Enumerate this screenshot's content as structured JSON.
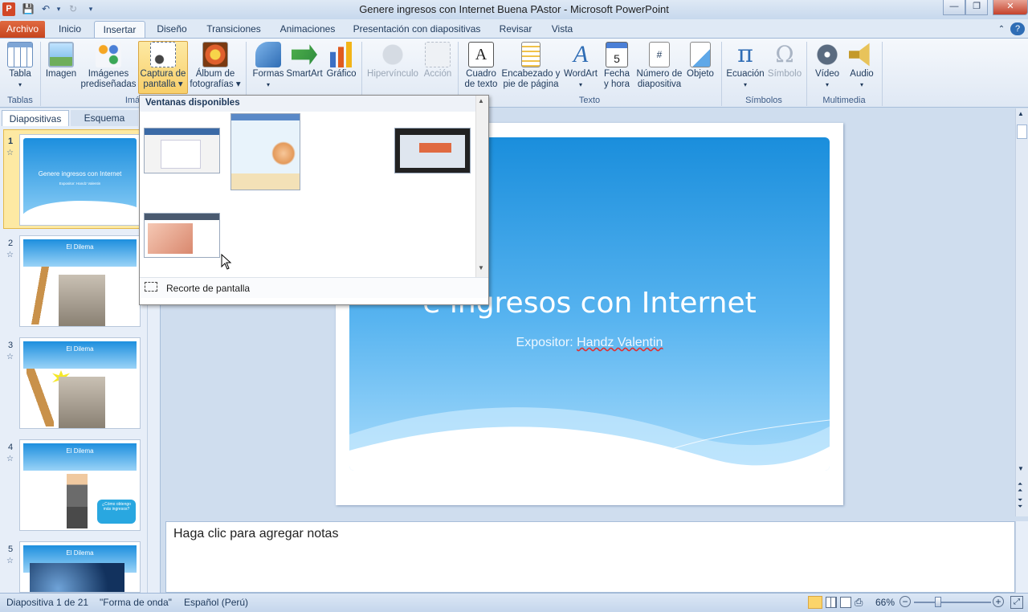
{
  "window": {
    "title": "Genere ingresos con Internet Buena PAstor  -  Microsoft PowerPoint",
    "app_icon_letter": "P",
    "minimize": "—",
    "maximize": "❐",
    "close": "✕"
  },
  "tabs": [
    "Archivo",
    "Inicio",
    "Insertar",
    "Diseño",
    "Transiciones",
    "Animaciones",
    "Presentación con diapositivas",
    "Revisar",
    "Vista"
  ],
  "active_tab": "Insertar",
  "ribbon": {
    "buttons": {
      "tabla": "Tabla",
      "imagen": "Imagen",
      "imagenes_l1": "Imágenes",
      "imagenes_l2": "prediseñadas",
      "captura_l1": "Captura de",
      "captura_l2": "pantalla ▾",
      "album_l1": "Álbum de",
      "album_l2": "fotografías ▾",
      "formas": "Formas",
      "smartart": "SmartArt",
      "grafico": "Gráfico",
      "hipervinculo": "Hipervínculo",
      "accion": "Acción",
      "cuadro_l1": "Cuadro",
      "cuadro_l2": "de texto",
      "encabezado_l1": "Encabezado y",
      "encabezado_l2": "pie de página",
      "wordart": "WordArt",
      "fecha_l1": "Fecha",
      "fecha_l2": "y hora",
      "numero_l1": "Número de",
      "numero_l2": "diapositiva",
      "objeto": "Objeto",
      "ecuacion": "Ecuación",
      "simbolo": "Símbolo",
      "video": "Vídeo",
      "audio": "Audio"
    },
    "groups": {
      "tablas": "Tablas",
      "imagenes": "Imá",
      "texto": "Texto",
      "simbolos": "Símbolos",
      "multimedia": "Multimedia"
    }
  },
  "dropdown": {
    "header": "Ventanas disponibles",
    "footer": "Recorte de pantalla"
  },
  "left_pane": {
    "tabs": [
      "Diapositivas",
      "Esquema"
    ],
    "slides": [
      {
        "num": "1",
        "title": "Genere ingresos con Internet",
        "sub": "Expositor: Handz Valentin"
      },
      {
        "num": "2",
        "title": "El Dilema"
      },
      {
        "num": "3",
        "title": "El Dilema"
      },
      {
        "num": "4",
        "title": "El Dilema",
        "bubble": "¿Cómo obtengo más ingresos?"
      },
      {
        "num": "5",
        "title": "El Dilema"
      }
    ]
  },
  "slide": {
    "title": "e ingresos con Internet",
    "subtitle_prefix": "Expositor: ",
    "subtitle_name": "Handz Valentin"
  },
  "notes_placeholder": "Haga clic para agregar notas",
  "status": {
    "slide_info": "Diapositiva 1 de 21",
    "theme": "\"Forma de onda\"",
    "language": "Español (Perú)",
    "zoom": "66%"
  }
}
